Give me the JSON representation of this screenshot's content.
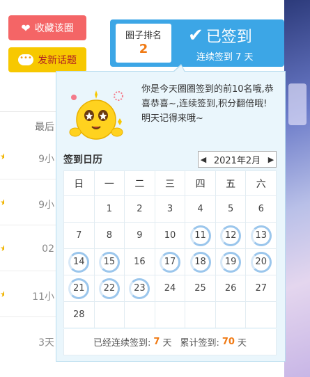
{
  "buttons": {
    "favorite": "收藏该圈",
    "post": "发新话题"
  },
  "background": {
    "column_header": "最后",
    "times": [
      "9小",
      "9小",
      "02",
      "11小",
      "3天"
    ]
  },
  "signin": {
    "rank_label": "圈子排名",
    "rank_value": "2",
    "status": "已签到",
    "streak_text": "连续签到 7 天"
  },
  "popup": {
    "message": "你是今天圈圈签到的前10名哦,恭喜恭喜~,连续签到,积分翻倍哦!明天记得来哦~",
    "calendar_title": "签到日历",
    "month": "2021年2月",
    "weekdays": [
      "日",
      "一",
      "二",
      "三",
      "四",
      "五",
      "六"
    ],
    "weeks": [
      [
        "",
        "1",
        "2",
        "3",
        "4",
        "5",
        "6"
      ],
      [
        "7",
        "8",
        "9",
        "10",
        "11",
        "12",
        "13"
      ],
      [
        "14",
        "15",
        "16",
        "17",
        "18",
        "19",
        "20"
      ],
      [
        "21",
        "22",
        "23",
        "24",
        "25",
        "26",
        "27"
      ],
      [
        "28",
        "",
        "",
        "",
        "",
        "",
        ""
      ]
    ],
    "signed_days": [
      "11",
      "12",
      "13",
      "14",
      "15",
      "17",
      "18",
      "19",
      "20",
      "21",
      "22",
      "23"
    ],
    "footer": {
      "consecutive_label": "已经连续签到:",
      "consecutive_value": "7",
      "day_unit": "天",
      "total_label": "累计签到:",
      "total_value": "70"
    }
  },
  "colors": {
    "accent": "#3ca6e6",
    "highlight": "#f07a14",
    "fav_button": "#f46566",
    "post_button": "#f7c800"
  }
}
